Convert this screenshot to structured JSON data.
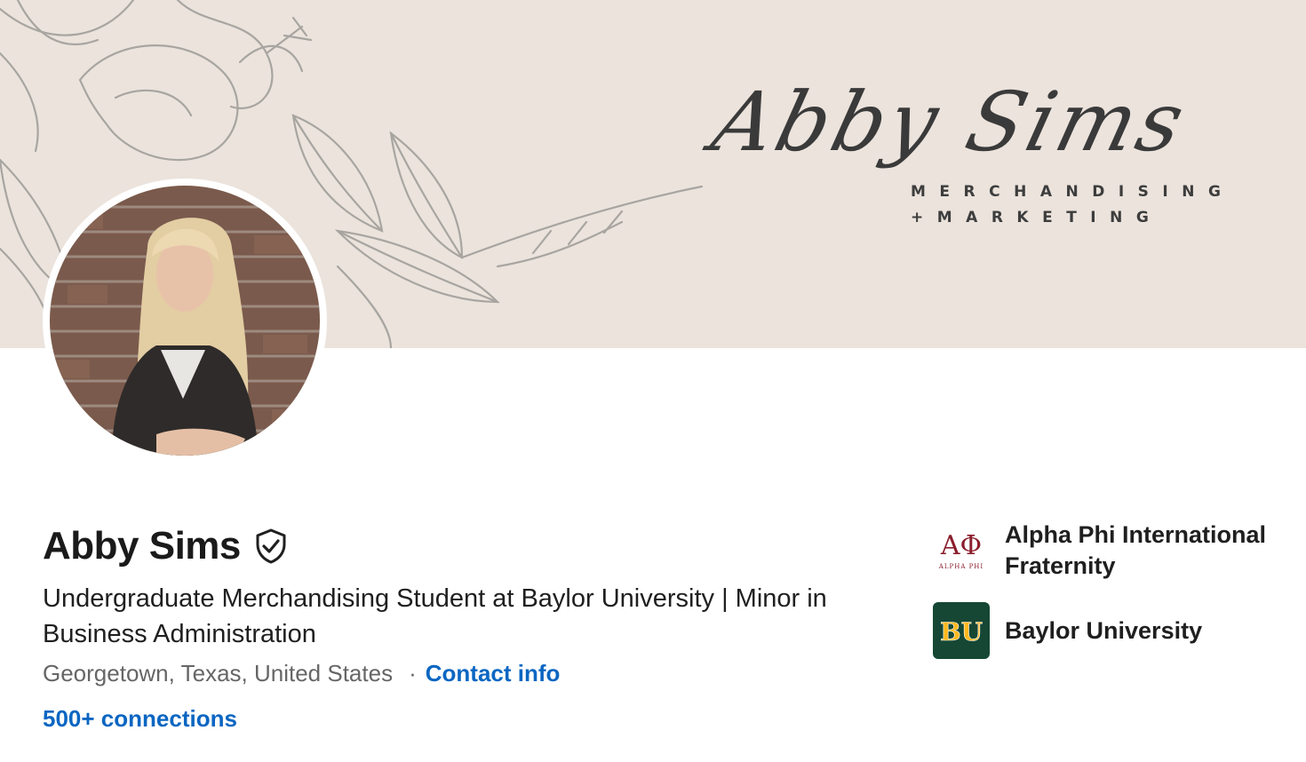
{
  "banner": {
    "script_name": "Abby Sims",
    "tagline_line1": "MERCHANDISING",
    "tagline_line2": "+MARKETING"
  },
  "profile": {
    "name": "Abby Sims",
    "verified_icon": "shield-check-icon",
    "headline": "Undergraduate Merchandising Student at Baylor University | Minor in Business Administration",
    "location": "Georgetown, Texas, United States",
    "separator": "·",
    "contact_label": "Contact info",
    "connections_label": "500+ connections"
  },
  "organizations": [
    {
      "name": "Alpha Phi International Fraternity",
      "logo_letters": "ΑΦ",
      "logo_caption": "ALPHA PHI",
      "logo_color": "#8b1e2d"
    },
    {
      "name": "Baylor University",
      "logo_letters": "BU",
      "logo_color": "#154734",
      "logo_accent": "#ffb81c"
    }
  ],
  "colors": {
    "link": "#0a66c2",
    "banner_bg": "#ebe3dc",
    "text_primary": "#1f1f1f",
    "text_secondary": "#666666"
  }
}
